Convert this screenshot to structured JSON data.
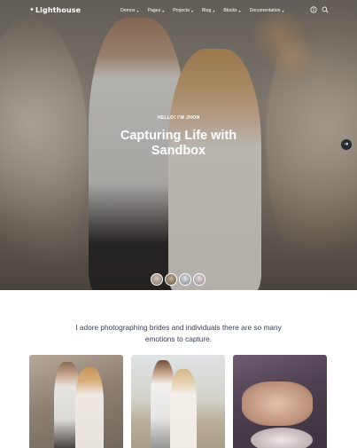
{
  "brand": {
    "logo_text": "Lighthouse"
  },
  "nav": {
    "items": [
      {
        "label": "Demos"
      },
      {
        "label": "Pages"
      },
      {
        "label": "Projects"
      },
      {
        "label": "Blog"
      },
      {
        "label": "Blocks"
      },
      {
        "label": "Documentation"
      }
    ],
    "icons": [
      "info-icon",
      "search-icon"
    ]
  },
  "hero": {
    "eyebrow": "HELLO! I'M JHON",
    "headline": "Capturing Life with Sandbox",
    "thumb_count": 4,
    "active_thumb": 1
  },
  "intro": {
    "tagline": "I adore photographing brides and individuals there are so many emotions to capture."
  },
  "colors": {
    "text": "#343f52",
    "arrow_bg": "#262b32"
  }
}
